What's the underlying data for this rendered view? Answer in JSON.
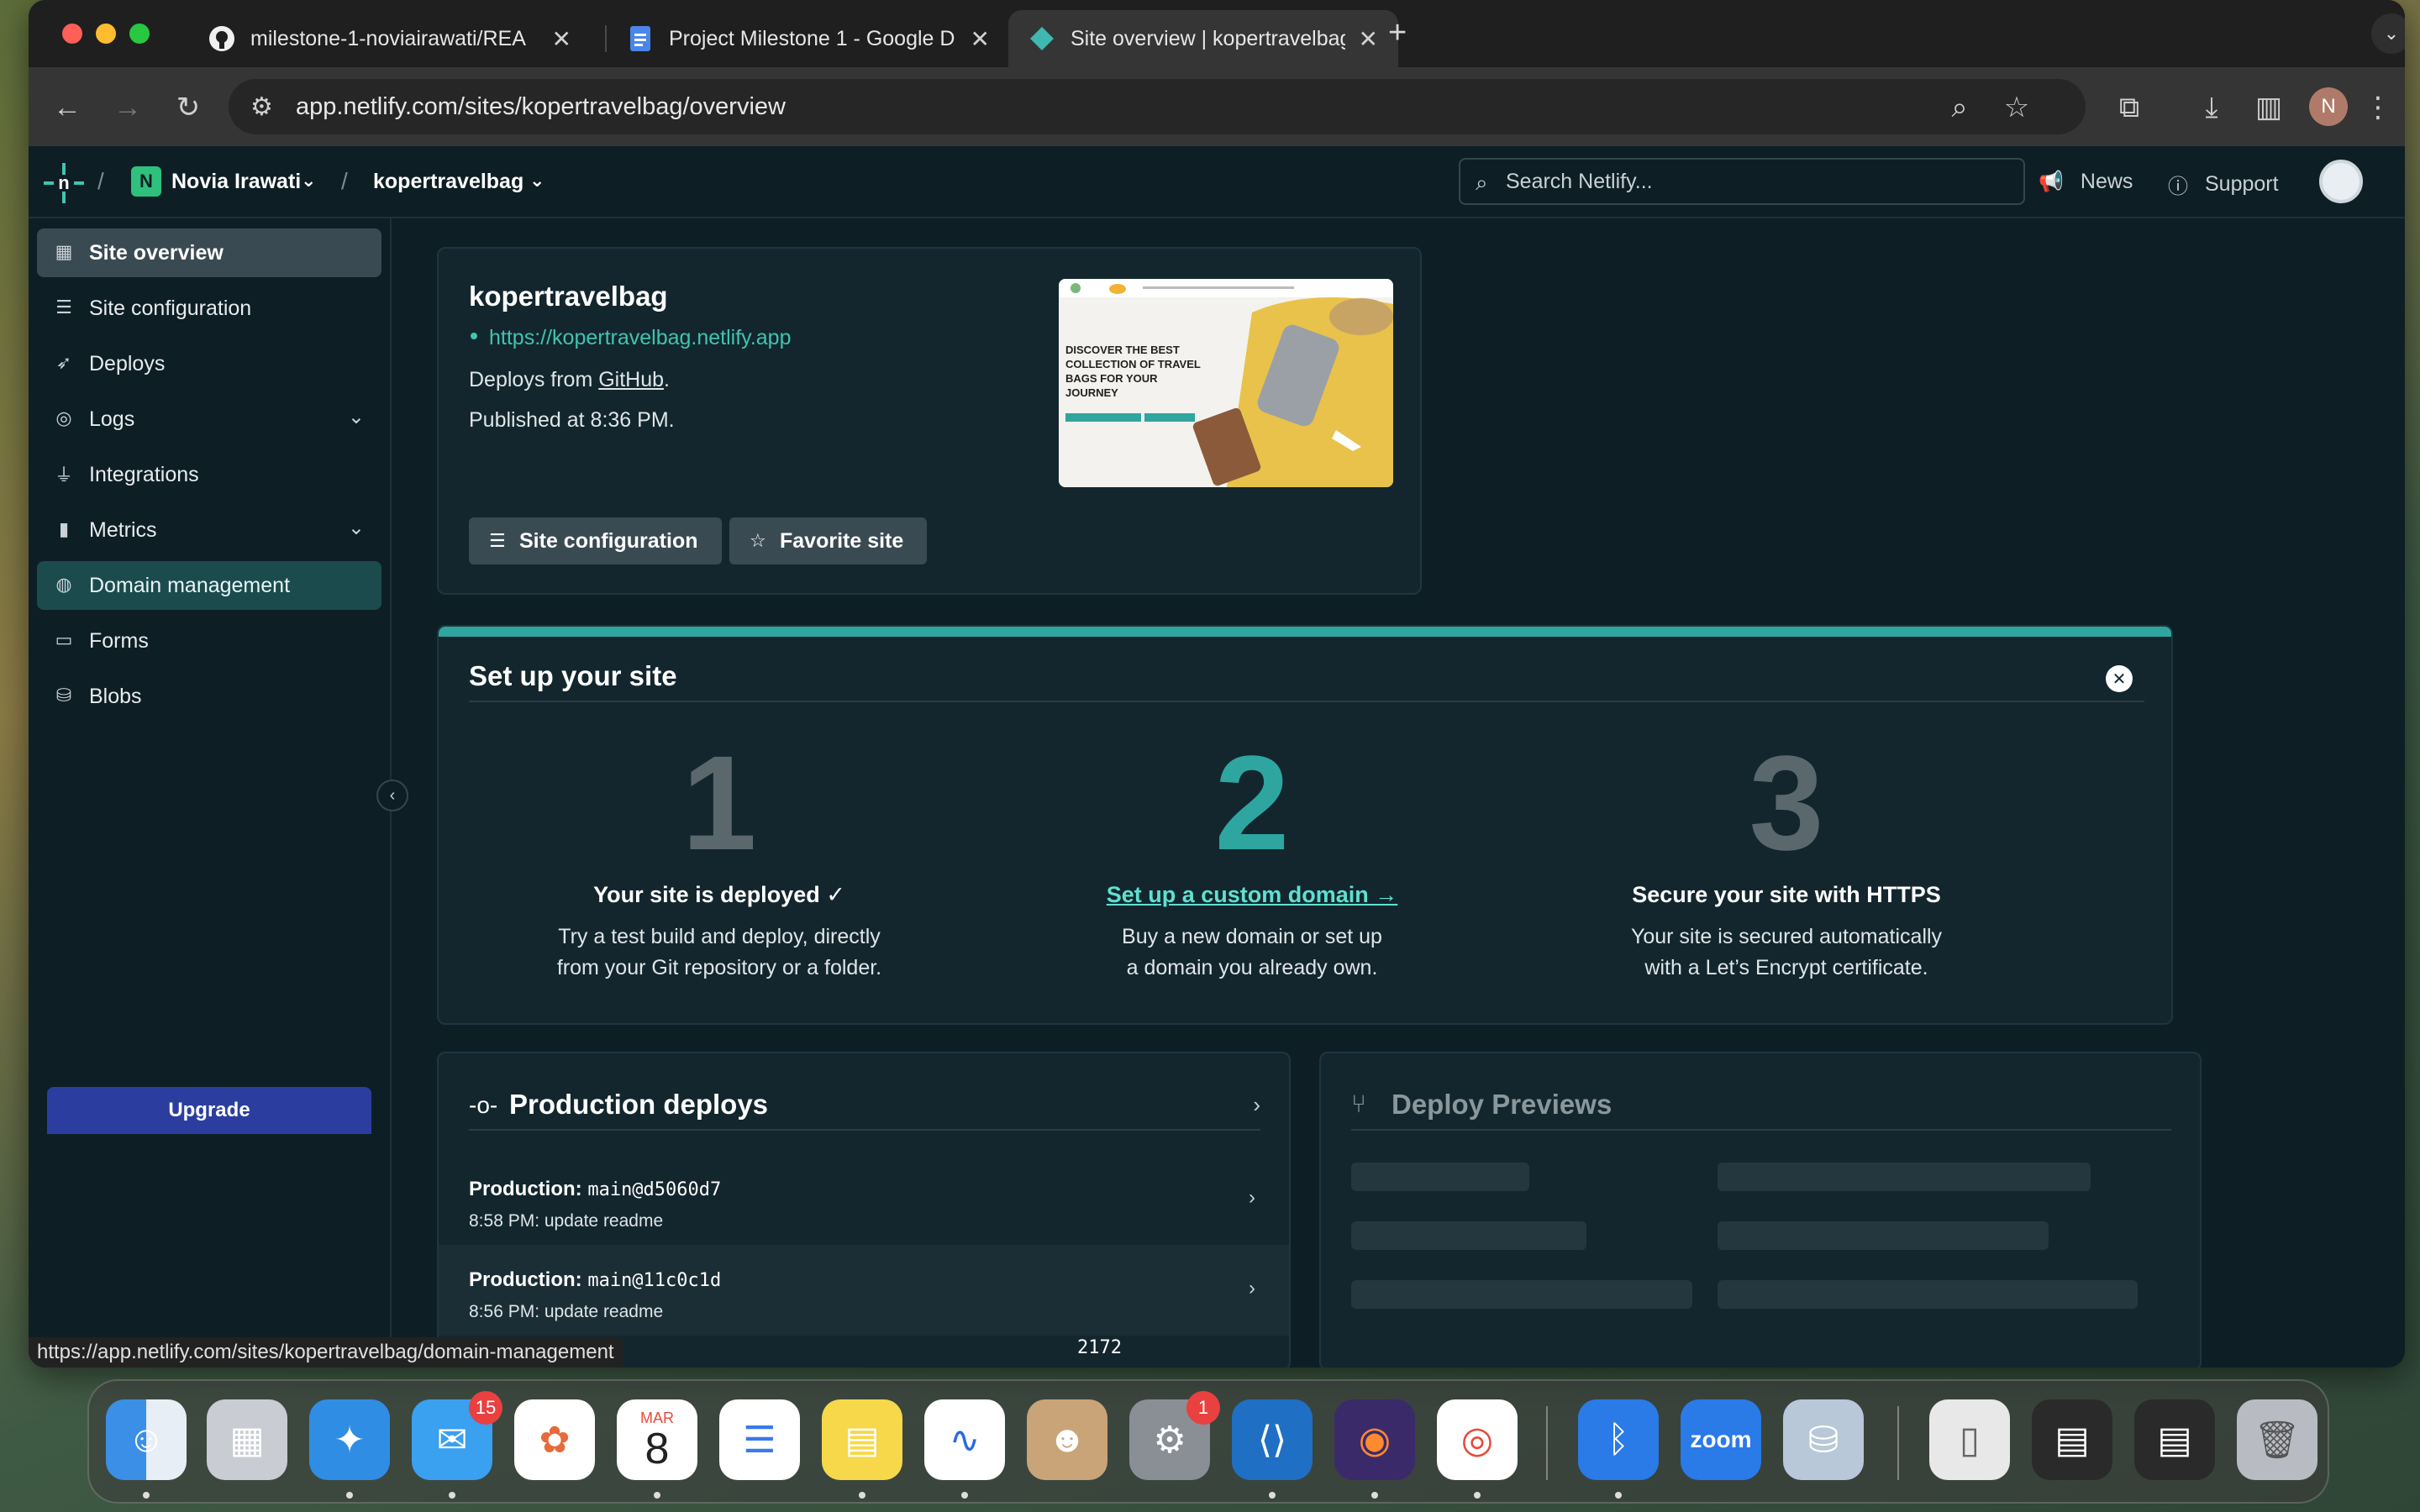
{
  "browser": {
    "tabs": [
      {
        "title": "milestone-1-noviairawati/REA",
        "icon": "github-icon"
      },
      {
        "title": "Project Milestone 1 - Google D",
        "icon": "google-docs-icon"
      },
      {
        "title": "Site overview | kopertravelbag",
        "icon": "netlify-icon"
      }
    ],
    "url": "app.netlify.com/sites/kopertravelbag/overview",
    "profile_initial": "N",
    "status_url": "https://app.netlify.com/sites/kopertravelbag/domain-management"
  },
  "header": {
    "team_initial": "N",
    "team_name": "Novia Irawati",
    "site_name": "kopertravelbag",
    "search_placeholder": "Search Netlify...",
    "news": "News",
    "support": "Support"
  },
  "sidebar": {
    "items": [
      {
        "label": "Site overview",
        "icon": "grid-icon"
      },
      {
        "label": "Site configuration",
        "icon": "config-icon"
      },
      {
        "label": "Deploys",
        "icon": "rocket-icon"
      },
      {
        "label": "Logs",
        "icon": "logs-icon"
      },
      {
        "label": "Integrations",
        "icon": "plug-icon"
      },
      {
        "label": "Metrics",
        "icon": "bar-chart-icon"
      },
      {
        "label": "Domain management",
        "icon": "globe-icon"
      },
      {
        "label": "Forms",
        "icon": "form-icon"
      },
      {
        "label": "Blobs",
        "icon": "database-icon"
      }
    ],
    "upgrade": "Upgrade"
  },
  "site": {
    "name": "kopertravelbag",
    "url": "https://kopertravelbag.netlify.app",
    "deploys_from_prefix": "Deploys from ",
    "deploys_from_link": "GitHub",
    "deploys_from_suffix": ".",
    "published": "Published at 8:36 PM.",
    "btn_config": "Site configuration",
    "btn_favorite": "Favorite site",
    "thumb_headline": "DISCOVER THE BEST COLLECTION OF TRAVEL BAGS FOR YOUR JOURNEY"
  },
  "setup": {
    "title": "Set up your site",
    "steps": [
      {
        "num": "1",
        "head": "Your site is deployed ✓",
        "desc1": "Try a test build and deploy, directly",
        "desc2": "from your Git repository or a folder."
      },
      {
        "num": "2",
        "head": "Set up a custom domain →",
        "desc1": "Buy a new domain or set up",
        "desc2": "a domain you already own."
      },
      {
        "num": "3",
        "head": "Secure your site with HTTPS",
        "desc1": "Your site is secured automatically",
        "desc2": "with a Let’s Encrypt certificate."
      }
    ]
  },
  "production": {
    "title": "Production deploys",
    "deploys": [
      {
        "label": "Production: ",
        "ref": "main@d5060d7",
        "meta": "8:58 PM: update readme"
      },
      {
        "label": "Production: ",
        "ref": "main@11c0c1d",
        "meta": "8:56 PM: update readme"
      }
    ],
    "partial": "2172"
  },
  "previews": {
    "title": "Deploy Previews"
  },
  "dock": {
    "mail_badge": "15",
    "calendar_month": "MAR",
    "calendar_day": "8",
    "settings_badge": "1",
    "zoom_label": "zoom"
  },
  "colors": {
    "bg": "#0e1e25",
    "card": "#13262e",
    "accent_teal": "#2fa5a0",
    "link_teal": "#40c4b0",
    "upgrade_blue": "#2b3ea0"
  }
}
